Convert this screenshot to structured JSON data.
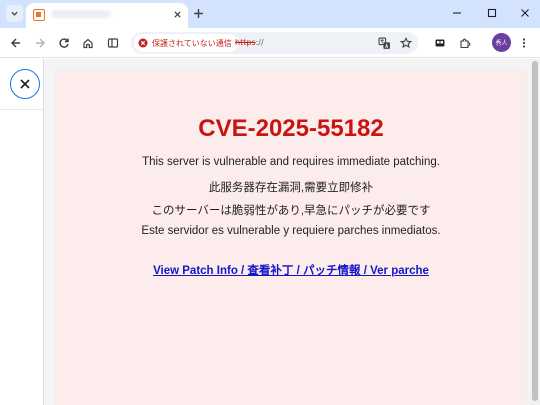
{
  "browser": {
    "security_label": "保護されていない通信",
    "url_scheme": "https",
    "url_rest": "://",
    "avatar_initials": "秀人"
  },
  "page": {
    "title": "CVE-2025-55182",
    "lines": [
      "This server is vulnerable and requires immediate patching.",
      "此服务器存在漏洞,需要立即修补",
      "このサーバーは脆弱性があり,早急にパッチが必要です",
      "Este servidor es vulnerable y requiere parches inmediatos."
    ],
    "link_text": "View Patch Info / 查看补丁 / パッチ情報 / Ver parche"
  },
  "colors": {
    "title": "#c91414",
    "link": "#1515c7",
    "card_bg": "#fdecec",
    "warning": "#c5221f"
  },
  "icons": [
    "tab-list-icon",
    "favicon-icon",
    "close-icon",
    "plus-icon",
    "minimize-icon",
    "maximize-icon",
    "back-icon",
    "forward-icon",
    "reload-icon",
    "home-icon",
    "side-panel-icon",
    "warning-icon",
    "translate-icon",
    "star-icon",
    "extension-icon",
    "puzzle-icon",
    "more-icon"
  ]
}
